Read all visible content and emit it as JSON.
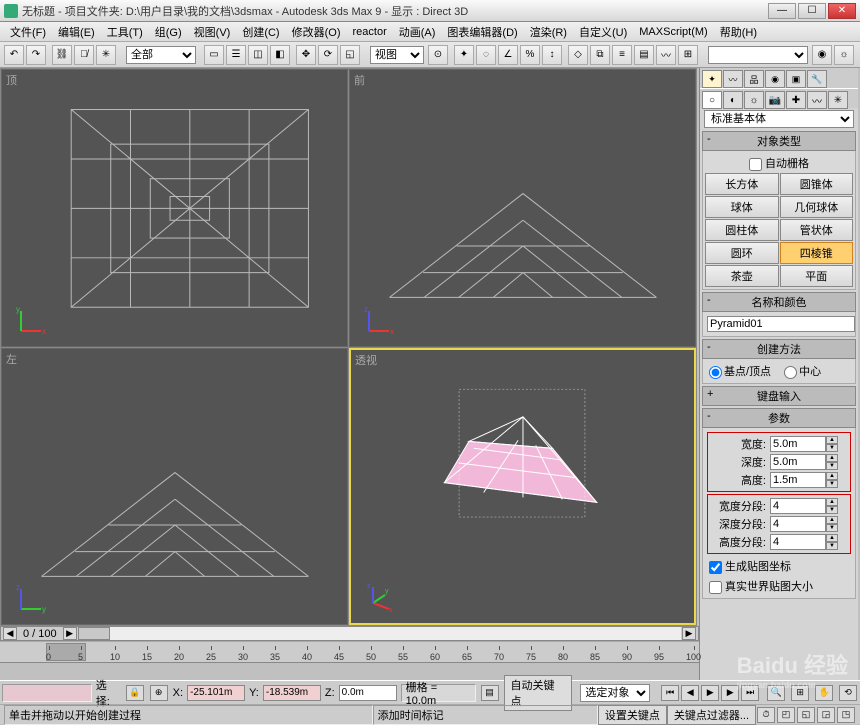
{
  "window": {
    "title": "无标题    - 项目文件夹: D:\\用户目录\\我的文档\\3dsmax      - Autodesk 3ds Max 9    - 显示 : Direct 3D"
  },
  "menu": [
    "文件(F)",
    "编辑(E)",
    "工具(T)",
    "组(G)",
    "视图(V)",
    "创建(C)",
    "修改器(O)",
    "reactor",
    "动画(A)",
    "图表编辑器(D)",
    "渲染(R)",
    "自定义(U)",
    "MAXScript(M)",
    "帮助(H)"
  ],
  "toolbar": {
    "selection_filter": "全部",
    "view_dropdown": "视图"
  },
  "viewports": {
    "top": "顶",
    "front": "前",
    "left": "左",
    "persp": "透视"
  },
  "panel": {
    "primitive_dropdown": "标准基本体",
    "obj_type_header": "对象类型",
    "auto_grid": "自动栅格",
    "primitives": [
      [
        "长方体",
        "圆锥体"
      ],
      [
        "球体",
        "几何球体"
      ],
      [
        "圆柱体",
        "管状体"
      ],
      [
        "圆环",
        "四棱锥"
      ],
      [
        "茶壶",
        "平面"
      ]
    ],
    "name_color_header": "名称和颜色",
    "object_name": "Pyramid01",
    "create_method_header": "创建方法",
    "radio_base": "基点/顶点",
    "radio_center": "中心",
    "keyboard_header": "键盘输入",
    "params_header": "参数",
    "width_label": "宽度:",
    "width_value": "5.0m",
    "depth_label": "深度:",
    "depth_value": "5.0m",
    "height_label": "高度:",
    "height_value": "1.5m",
    "wseg_label": "宽度分段:",
    "wseg_value": "4",
    "dseg_label": "深度分段:",
    "dseg_value": "4",
    "hseg_label": "高度分段:",
    "hseg_value": "4",
    "gen_uv": "生成贴图坐标",
    "real_world": "真实世界贴图大小"
  },
  "timeline": {
    "frame_display": "0   /  100",
    "ticks": [
      0,
      5,
      10,
      15,
      20,
      25,
      30,
      35,
      40,
      45,
      50,
      55,
      60,
      65,
      70,
      75,
      80,
      85,
      90,
      95,
      100
    ]
  },
  "status": {
    "select_label": "选择:",
    "x_label": "X:",
    "x_val": "-25.101m",
    "y_label": "Y:",
    "y_val": "-18.539m",
    "z_label": "Z:",
    "z_val": "0.0m",
    "grid": "栅格 = 10.0m",
    "autokey": "自动关键点",
    "selected": "选定对象",
    "setkey": "设置关键点",
    "keyfilter": "关键点过滤器..."
  },
  "prompt": {
    "line1": "单击并拖动以开始创建过程",
    "line2": "添加时间标记"
  },
  "watermark": {
    "brand": "Baidu 经验",
    "url": "jingyan.baidu.com"
  }
}
